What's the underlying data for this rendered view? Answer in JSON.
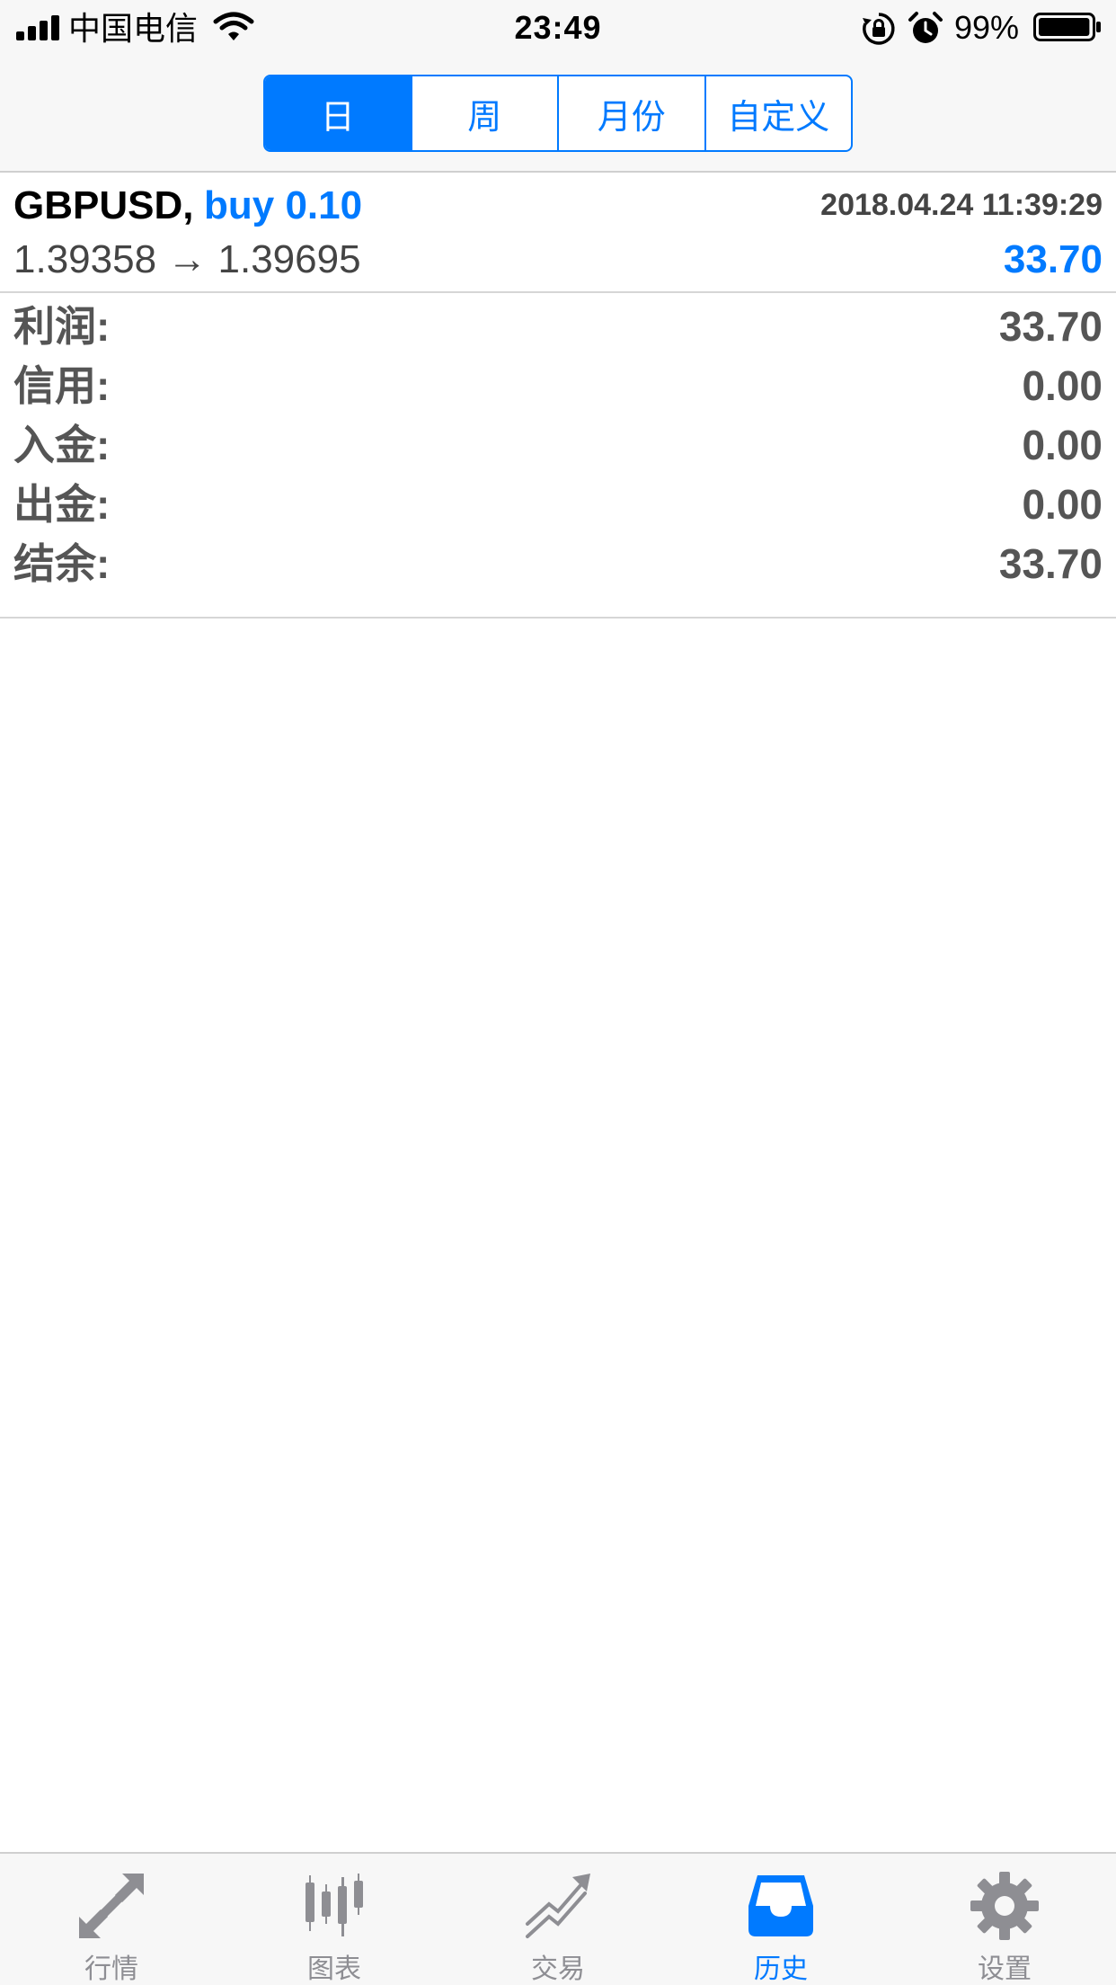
{
  "status_bar": {
    "carrier": "中国电信",
    "time": "23:49",
    "battery_percent": "99%",
    "battery_level": 0.99,
    "icons": [
      "signal-icon",
      "wifi-icon",
      "rotation-lock-icon",
      "alarm-icon",
      "battery-icon"
    ]
  },
  "segments": {
    "items": [
      {
        "label": "日"
      },
      {
        "label": "周"
      },
      {
        "label": "月份"
      },
      {
        "label": "自定义"
      }
    ],
    "selected": "日"
  },
  "trade": {
    "symbol": "GBPUSD,",
    "direction": "buy 0.10",
    "time": "2018.04.24 11:39:29",
    "prices": "1.39358 → 1.39695",
    "profit": "33.70"
  },
  "summary": [
    {
      "label": "利润:",
      "value": "33.70"
    },
    {
      "label": "信用:",
      "value": "0.00"
    },
    {
      "label": "入金:",
      "value": "0.00"
    },
    {
      "label": "出金:",
      "value": "0.00"
    },
    {
      "label": "结余:",
      "value": "33.70"
    }
  ],
  "tabbar": {
    "items": [
      {
        "label": "行情",
        "icon": "quotes-arrows-icon"
      },
      {
        "label": "图表",
        "icon": "candlestick-chart-icon"
      },
      {
        "label": "交易",
        "icon": "trade-trend-icon"
      },
      {
        "label": "历史",
        "icon": "history-inbox-icon"
      },
      {
        "label": "设置",
        "icon": "gear-icon"
      }
    ],
    "active": "历史"
  },
  "colors": {
    "accent": "#007aff",
    "inactive_tab": "#8e8e93",
    "value_text": "#555555"
  }
}
